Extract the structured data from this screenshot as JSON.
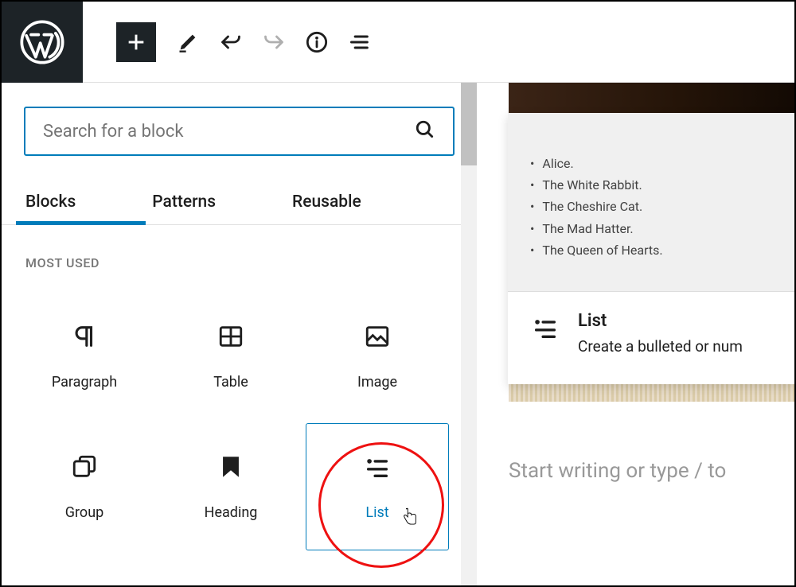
{
  "search": {
    "placeholder": "Search for a block"
  },
  "tabs": [
    "Blocks",
    "Patterns",
    "Reusable"
  ],
  "sectionLabel": "MOST USED",
  "blocks": [
    {
      "name": "Paragraph"
    },
    {
      "name": "Table"
    },
    {
      "name": "Image"
    },
    {
      "name": "Group"
    },
    {
      "name": "Heading"
    },
    {
      "name": "List"
    }
  ],
  "preview": {
    "items": [
      "Alice.",
      "The White Rabbit.",
      "The Cheshire Cat.",
      "The Mad Hatter.",
      "The Queen of Hearts."
    ],
    "title": "List",
    "description": "Create a bulleted or num"
  },
  "canvas": {
    "placeholder": "Start writing or type / to"
  }
}
